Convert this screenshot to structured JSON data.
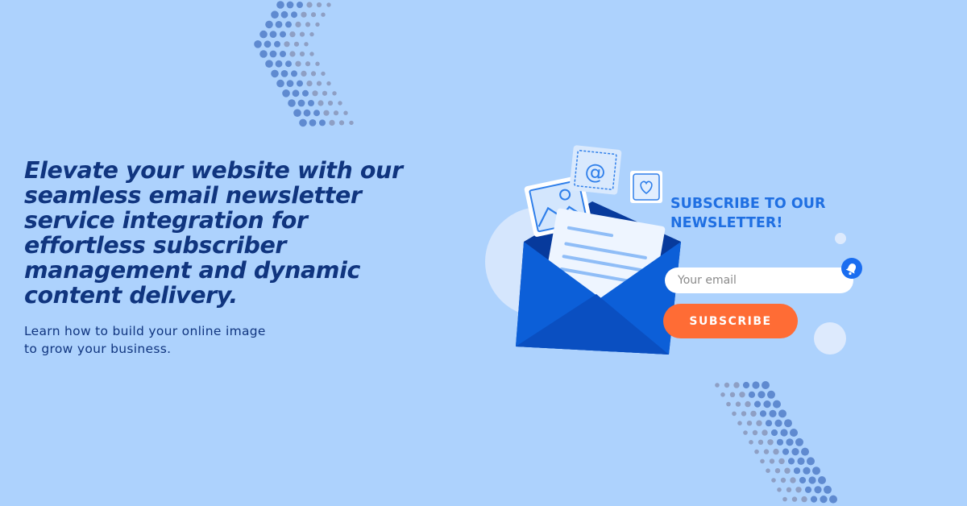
{
  "banner": {
    "headline": "Elevate your website with our seamless email newsletter service integration for effortless subscriber management and dynamic content delivery.",
    "subtext": "Learn how to build your online image to grow your business."
  },
  "newsletter_card": {
    "title": "SUBSCRIBE TO OUR NEWSLETTER!",
    "email_placeholder": "Your email",
    "subscribe_label": "SUBSCRIBE",
    "at_symbol": "@"
  },
  "colors": {
    "background": "#add2fd",
    "headline": "#10357f",
    "accent_blue": "#1f6fe2",
    "envelope_blue": "#0c5fd8",
    "button_orange": "#ff6c35"
  },
  "icons": [
    "envelope-icon",
    "image-card-icon",
    "at-sign-icon",
    "heart-card-icon",
    "bell-icon",
    "dot-chevron-decoration"
  ]
}
